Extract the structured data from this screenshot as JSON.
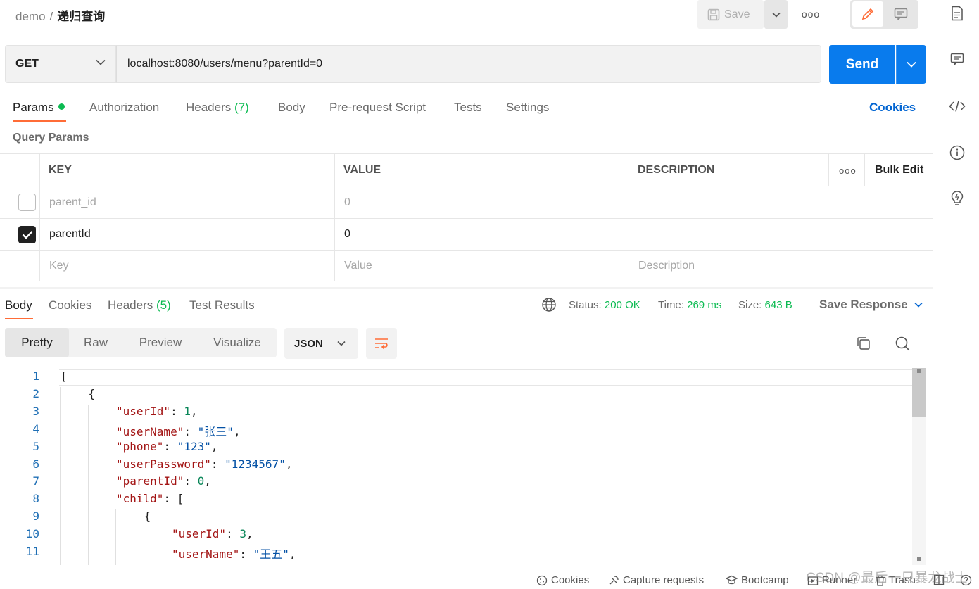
{
  "header": {
    "workspace": "demo",
    "separator": "/",
    "request_name": "递归查询",
    "save_label": "Save",
    "more_label": "ooo"
  },
  "request": {
    "method": "GET",
    "url": "localhost:8080/users/menu?parentId=0",
    "send_label": "Send"
  },
  "tabs": [
    {
      "label": "Params"
    },
    {
      "label": "Authorization"
    },
    {
      "label": "Headers",
      "count": "(7)"
    },
    {
      "label": "Body"
    },
    {
      "label": "Pre-request Script"
    },
    {
      "label": "Tests"
    },
    {
      "label": "Settings"
    }
  ],
  "cookies_link": "Cookies",
  "query_params": {
    "title": "Query Params",
    "columns": [
      "KEY",
      "VALUE",
      "DESCRIPTION"
    ],
    "more_label": "ooo",
    "bulk_edit": "Bulk Edit",
    "rows": [
      {
        "checked": false,
        "key": "parent_id",
        "value": "0",
        "description": ""
      },
      {
        "checked": true,
        "key": "parentId",
        "value": "0",
        "description": ""
      }
    ],
    "placeholder": {
      "key": "Key",
      "value": "Value",
      "description": "Description"
    }
  },
  "response": {
    "tabs": [
      {
        "label": "Body"
      },
      {
        "label": "Cookies"
      },
      {
        "label": "Headers",
        "count": "(5)"
      },
      {
        "label": "Test Results"
      }
    ],
    "status_label": "Status:",
    "status_value": "200 OK",
    "time_label": "Time:",
    "time_value": "269 ms",
    "size_label": "Size:",
    "size_value": "643 B",
    "save_response": "Save Response",
    "view_modes": [
      "Pretty",
      "Raw",
      "Preview",
      "Visualize"
    ],
    "format": "JSON",
    "lines": [
      {
        "n": "1",
        "indent": 0,
        "tokens": [
          [
            "p",
            "["
          ]
        ]
      },
      {
        "n": "2",
        "indent": 1,
        "tokens": [
          [
            "p",
            "{"
          ]
        ]
      },
      {
        "n": "3",
        "indent": 2,
        "tokens": [
          [
            "k",
            "\"userId\""
          ],
          [
            "p",
            ": "
          ],
          [
            "n",
            "1"
          ],
          [
            "p",
            ","
          ]
        ]
      },
      {
        "n": "4",
        "indent": 2,
        "tokens": [
          [
            "k",
            "\"userName\""
          ],
          [
            "p",
            ": "
          ],
          [
            "s",
            "\"张三\""
          ],
          [
            "p",
            ","
          ]
        ]
      },
      {
        "n": "5",
        "indent": 2,
        "tokens": [
          [
            "k",
            "\"phone\""
          ],
          [
            "p",
            ": "
          ],
          [
            "s",
            "\"123\""
          ],
          [
            "p",
            ","
          ]
        ]
      },
      {
        "n": "6",
        "indent": 2,
        "tokens": [
          [
            "k",
            "\"userPassword\""
          ],
          [
            "p",
            ": "
          ],
          [
            "s",
            "\"1234567\""
          ],
          [
            "p",
            ","
          ]
        ]
      },
      {
        "n": "7",
        "indent": 2,
        "tokens": [
          [
            "k",
            "\"parentId\""
          ],
          [
            "p",
            ": "
          ],
          [
            "n",
            "0"
          ],
          [
            "p",
            ","
          ]
        ]
      },
      {
        "n": "8",
        "indent": 2,
        "tokens": [
          [
            "k",
            "\"child\""
          ],
          [
            "p",
            ": ["
          ]
        ]
      },
      {
        "n": "9",
        "indent": 3,
        "tokens": [
          [
            "p",
            "{"
          ]
        ]
      },
      {
        "n": "10",
        "indent": 4,
        "tokens": [
          [
            "k",
            "\"userId\""
          ],
          [
            "p",
            ": "
          ],
          [
            "n",
            "3"
          ],
          [
            "p",
            ","
          ]
        ]
      },
      {
        "n": "11",
        "indent": 4,
        "tokens": [
          [
            "k",
            "\"userName\""
          ],
          [
            "p",
            ": "
          ],
          [
            "s",
            "\"王五\""
          ],
          [
            "p",
            ","
          ]
        ]
      }
    ]
  },
  "footer": {
    "cookies": "Cookies",
    "capture": "Capture requests",
    "bootcamp": "Bootcamp",
    "runner": "Runner",
    "trash": "Trash"
  },
  "watermark": "CSDN @最后一只暴龙战士"
}
